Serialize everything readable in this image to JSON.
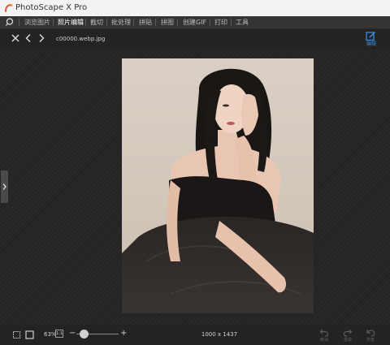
{
  "app": {
    "title": "PhotoScape X Pro"
  },
  "menu": {
    "items": [
      {
        "label": "浏览图片",
        "active": false
      },
      {
        "label": "照片编辑",
        "active": true
      },
      {
        "label": "截切",
        "active": false
      },
      {
        "label": "批处理",
        "active": false
      },
      {
        "label": "拼贴",
        "active": false
      },
      {
        "label": "拼图",
        "active": false
      },
      {
        "label": "创建GIF",
        "active": false
      },
      {
        "label": "打印",
        "active": false
      },
      {
        "label": "工具",
        "active": false
      }
    ]
  },
  "toolbar": {
    "filename": "c00000.webp.jpg",
    "edit_label": "编辑"
  },
  "bottom": {
    "zoom": "63%",
    "ratio": "1:1",
    "dimensions": "1000 x 1437",
    "undo_label": "撤消",
    "redo_label": "重做",
    "revert_label": "恢复"
  },
  "colors": {
    "accent": "#3a8de0",
    "background": "#1e1e1e",
    "menubar": "#343434"
  }
}
